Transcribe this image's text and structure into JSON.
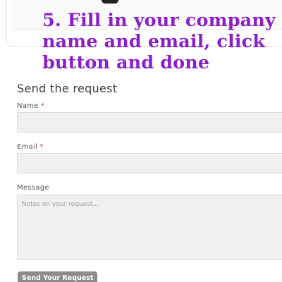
{
  "instruction": {
    "line1": "5. Fill in your company",
    "line2": "name and email, click",
    "line3": "button and done",
    "color": "#8a1fc9"
  },
  "form": {
    "title": "Send the request",
    "required_marker": "*",
    "name": {
      "label": "Name",
      "value": ""
    },
    "email": {
      "label": "Email",
      "value": ""
    },
    "message": {
      "label": "Message",
      "placeholder": "Notes on your request..."
    },
    "submit_label": "Send Your Request",
    "submit_color": "#8c8c8c"
  }
}
